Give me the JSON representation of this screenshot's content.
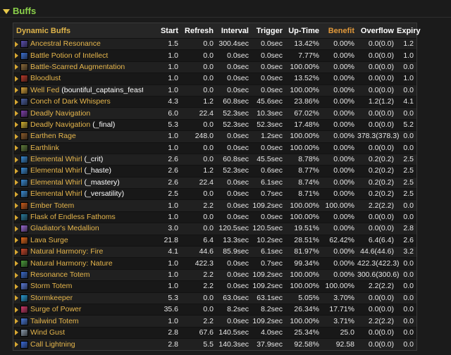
{
  "section": {
    "title": "Buffs"
  },
  "table": {
    "headers": {
      "name": "Dynamic Buffs",
      "start": "Start",
      "refresh": "Refresh",
      "interval": "Interval",
      "trigger": "Trigger",
      "uptime": "Up-Time",
      "benefit": "Benefit",
      "overflow": "Overflow",
      "expiry": "Expiry"
    },
    "rows": [
      {
        "name": "Ancestral Resonance",
        "suffix": "",
        "icon": "ancestral-resonance-icon",
        "color": "#5a4fb0",
        "start": "1.5",
        "refresh": "0.0",
        "interval": "300.4sec",
        "trigger": "0.0sec",
        "uptime": "13.42%",
        "benefit": "0.00%",
        "overflow": "0.0(0.0)",
        "expiry": "1.2"
      },
      {
        "name": "Battle Potion of Intellect",
        "suffix": "",
        "icon": "battle-potion-icon",
        "color": "#3b6fd1",
        "start": "1.0",
        "refresh": "0.0",
        "interval": "0.0sec",
        "trigger": "0.0sec",
        "uptime": "7.77%",
        "benefit": "0.00%",
        "overflow": "0.0(0.0)",
        "expiry": "1.0"
      },
      {
        "name": "Battle-Scarred Augmentation",
        "suffix": "",
        "icon": "augmentation-rune-icon",
        "color": "#8a6a3a",
        "start": "1.0",
        "refresh": "0.0",
        "interval": "0.0sec",
        "trigger": "0.0sec",
        "uptime": "100.00%",
        "benefit": "0.00%",
        "overflow": "0.0(0.0)",
        "expiry": "0.0"
      },
      {
        "name": "Bloodlust",
        "suffix": "",
        "icon": "bloodlust-icon",
        "color": "#b83a2a",
        "start": "1.0",
        "refresh": "0.0",
        "interval": "0.0sec",
        "trigger": "0.0sec",
        "uptime": "13.52%",
        "benefit": "0.00%",
        "overflow": "0.0(0.0)",
        "expiry": "1.0"
      },
      {
        "name": "Well Fed",
        "suffix": "(bountiful_captains_feast)",
        "icon": "well-fed-icon",
        "color": "#d6a23a",
        "start": "1.0",
        "refresh": "0.0",
        "interval": "0.0sec",
        "trigger": "0.0sec",
        "uptime": "100.00%",
        "benefit": "0.00%",
        "overflow": "0.0(0.0)",
        "expiry": "0.0"
      },
      {
        "name": "Conch of Dark Whispers",
        "suffix": "",
        "icon": "conch-icon",
        "color": "#4a5fa0",
        "start": "4.3",
        "refresh": "1.2",
        "interval": "60.8sec",
        "trigger": "45.6sec",
        "uptime": "23.86%",
        "benefit": "0.00%",
        "overflow": "1.2(1.2)",
        "expiry": "4.1"
      },
      {
        "name": "Deadly Navigation",
        "suffix": "",
        "icon": "deadly-navigation-icon",
        "color": "#7d3fa8",
        "start": "6.0",
        "refresh": "22.4",
        "interval": "52.3sec",
        "trigger": "10.3sec",
        "uptime": "67.02%",
        "benefit": "0.00%",
        "overflow": "0.0(0.0)",
        "expiry": "0.0"
      },
      {
        "name": "Deadly Navigation",
        "suffix": "(_final)",
        "icon": "deadly-navigation-final-icon",
        "color": "#d0b030",
        "start": "5.3",
        "refresh": "0.0",
        "interval": "52.3sec",
        "trigger": "52.3sec",
        "uptime": "17.48%",
        "benefit": "0.00%",
        "overflow": "0.0(0.0)",
        "expiry": "5.2"
      },
      {
        "name": "Earthen Rage",
        "suffix": "",
        "icon": "earthen-rage-icon",
        "color": "#8a5a2a",
        "start": "1.0",
        "refresh": "248.0",
        "interval": "0.0sec",
        "trigger": "1.2sec",
        "uptime": "100.00%",
        "benefit": "0.00%",
        "overflow": "378.3(378.3)",
        "expiry": "0.0"
      },
      {
        "name": "Earthlink",
        "suffix": "",
        "icon": "earthlink-icon",
        "color": "#5f7a3a",
        "start": "1.0",
        "refresh": "0.0",
        "interval": "0.0sec",
        "trigger": "0.0sec",
        "uptime": "100.00%",
        "benefit": "0.00%",
        "overflow": "0.0(0.0)",
        "expiry": "0.0"
      },
      {
        "name": "Elemental Whirl",
        "suffix": "(_crit)",
        "icon": "elemental-whirl-crit-icon",
        "color": "#3a8ad1",
        "start": "2.6",
        "refresh": "0.0",
        "interval": "60.8sec",
        "trigger": "45.5sec",
        "uptime": "8.78%",
        "benefit": "0.00%",
        "overflow": "0.2(0.2)",
        "expiry": "2.5"
      },
      {
        "name": "Elemental Whirl",
        "suffix": "(_haste)",
        "icon": "elemental-whirl-haste-icon",
        "color": "#3a8ad1",
        "start": "2.6",
        "refresh": "1.2",
        "interval": "52.3sec",
        "trigger": "0.6sec",
        "uptime": "8.77%",
        "benefit": "0.00%",
        "overflow": "0.2(0.2)",
        "expiry": "2.5"
      },
      {
        "name": "Elemental Whirl",
        "suffix": "(_mastery)",
        "icon": "elemental-whirl-mastery-icon",
        "color": "#3a8ad1",
        "start": "2.6",
        "refresh": "22.4",
        "interval": "0.0sec",
        "trigger": "6.1sec",
        "uptime": "8.74%",
        "benefit": "0.00%",
        "overflow": "0.2(0.2)",
        "expiry": "2.5"
      },
      {
        "name": "Elemental Whirl",
        "suffix": "(_versatility)",
        "icon": "elemental-whirl-versatility-icon",
        "color": "#3a8ad1",
        "start": "2.5",
        "refresh": "0.0",
        "interval": "0.0sec",
        "trigger": "0.7sec",
        "uptime": "8.71%",
        "benefit": "0.00%",
        "overflow": "0.2(0.2)",
        "expiry": "2.5"
      },
      {
        "name": "Ember Totem",
        "suffix": "",
        "icon": "ember-totem-icon",
        "color": "#c85a1a",
        "start": "1.0",
        "refresh": "2.2",
        "interval": "0.0sec",
        "trigger": "109.2sec",
        "uptime": "100.00%",
        "benefit": "100.00%",
        "overflow": "2.2(2.2)",
        "expiry": "0.0"
      },
      {
        "name": "Flask of Endless Fathoms",
        "suffix": "",
        "icon": "flask-icon",
        "color": "#2a7a9a",
        "start": "1.0",
        "refresh": "0.0",
        "interval": "0.0sec",
        "trigger": "0.0sec",
        "uptime": "100.00%",
        "benefit": "0.00%",
        "overflow": "0.0(0.0)",
        "expiry": "0.0"
      },
      {
        "name": "Gladiator's Medallion",
        "suffix": "",
        "icon": "medallion-icon",
        "color": "#9a6ad0",
        "start": "3.0",
        "refresh": "0.0",
        "interval": "120.5sec",
        "trigger": "120.5sec",
        "uptime": "19.51%",
        "benefit": "0.00%",
        "overflow": "0.0(0.0)",
        "expiry": "2.8"
      },
      {
        "name": "Lava Surge",
        "suffix": "",
        "icon": "lava-surge-icon",
        "color": "#e0661a",
        "start": "21.8",
        "refresh": "6.4",
        "interval": "13.3sec",
        "trigger": "10.2sec",
        "uptime": "28.51%",
        "benefit": "62.42%",
        "overflow": "6.4(6.4)",
        "expiry": "2.6"
      },
      {
        "name": "Natural Harmony: Fire",
        "suffix": "",
        "icon": "natural-harmony-fire-icon",
        "color": "#c8462a",
        "start": "4.1",
        "refresh": "44.6",
        "interval": "85.9sec",
        "trigger": "6.1sec",
        "uptime": "81.97%",
        "benefit": "0.00%",
        "overflow": "44.6(44.6)",
        "expiry": "3.2"
      },
      {
        "name": "Natural Harmony: Nature",
        "suffix": "",
        "icon": "natural-harmony-nature-icon",
        "color": "#4a9a3a",
        "start": "1.0",
        "refresh": "422.3",
        "interval": "0.0sec",
        "trigger": "0.7sec",
        "uptime": "99.34%",
        "benefit": "0.00%",
        "overflow": "422.3(422.3)",
        "expiry": "0.0"
      },
      {
        "name": "Resonance Totem",
        "suffix": "",
        "icon": "resonance-totem-icon",
        "color": "#3a6ac8",
        "start": "1.0",
        "refresh": "2.2",
        "interval": "0.0sec",
        "trigger": "109.2sec",
        "uptime": "100.00%",
        "benefit": "0.00%",
        "overflow": "300.6(300.6)",
        "expiry": "0.0"
      },
      {
        "name": "Storm Totem",
        "suffix": "",
        "icon": "storm-totem-icon",
        "color": "#5a7ad8",
        "start": "1.0",
        "refresh": "2.2",
        "interval": "0.0sec",
        "trigger": "109.2sec",
        "uptime": "100.00%",
        "benefit": "100.00%",
        "overflow": "2.2(2.2)",
        "expiry": "0.0"
      },
      {
        "name": "Stormkeeper",
        "suffix": "",
        "icon": "stormkeeper-icon",
        "color": "#2a9ad0",
        "start": "5.3",
        "refresh": "0.0",
        "interval": "63.0sec",
        "trigger": "63.1sec",
        "uptime": "5.05%",
        "benefit": "3.70%",
        "overflow": "0.0(0.0)",
        "expiry": "0.0"
      },
      {
        "name": "Surge of Power",
        "suffix": "",
        "icon": "surge-of-power-icon",
        "color": "#d03a6a",
        "start": "35.6",
        "refresh": "0.0",
        "interval": "8.2sec",
        "trigger": "8.2sec",
        "uptime": "26.34%",
        "benefit": "17.71%",
        "overflow": "0.0(0.0)",
        "expiry": "0.0"
      },
      {
        "name": "Tailwind Totem",
        "suffix": "",
        "icon": "tailwind-totem-icon",
        "color": "#4a7ad8",
        "start": "1.0",
        "refresh": "2.2",
        "interval": "0.0sec",
        "trigger": "109.2sec",
        "uptime": "100.00%",
        "benefit": "3.71%",
        "overflow": "2.2(2.2)",
        "expiry": "0.0"
      },
      {
        "name": "Wind Gust",
        "suffix": "",
        "icon": "wind-gust-icon",
        "color": "#8a9aaa",
        "start": "2.8",
        "refresh": "67.6",
        "interval": "140.5sec",
        "trigger": "4.0sec",
        "uptime": "25.34%",
        "benefit": "25.0",
        "overflow": "0.0(0.0)",
        "expiry": "0.0"
      },
      {
        "name": "Call Lightning",
        "suffix": "",
        "icon": "call-lightning-icon",
        "color": "#3a6ad8",
        "start": "2.8",
        "refresh": "5.5",
        "interval": "140.3sec",
        "trigger": "37.9sec",
        "uptime": "92.58%",
        "benefit": "92.58",
        "overflow": "0.0(0.0)",
        "expiry": "0.0"
      }
    ]
  }
}
